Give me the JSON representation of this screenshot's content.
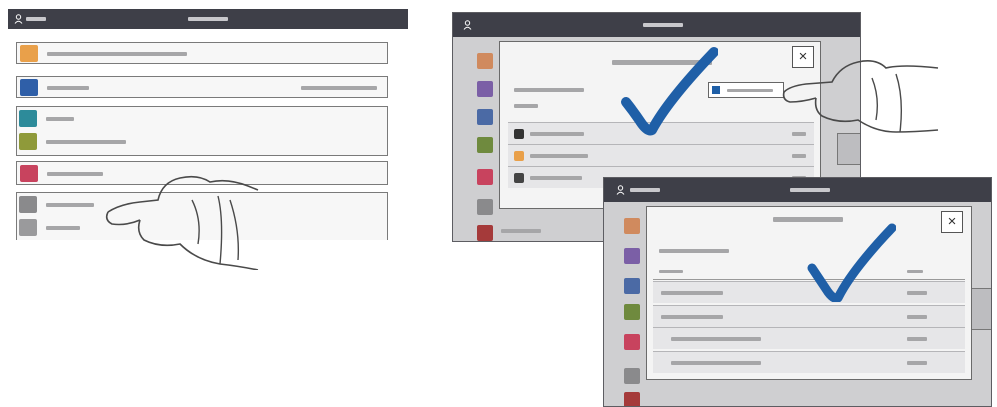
{
  "colors": {
    "bar": "#3e3f48",
    "checkmark": "#1f5fa7",
    "tile_orange": "#e9a04a",
    "tile_blue": "#2f5fa8",
    "tile_teal": "#2d8b9a",
    "tile_olive": "#8f9a3a",
    "tile_pink": "#c8435e",
    "tile_gray": "#8a8a8c"
  },
  "icons": {
    "user": "person-icon",
    "close": "close-icon",
    "check": "checkmark-icon",
    "hand": "pointing-hand-illustration"
  },
  "close_symbol": "×"
}
